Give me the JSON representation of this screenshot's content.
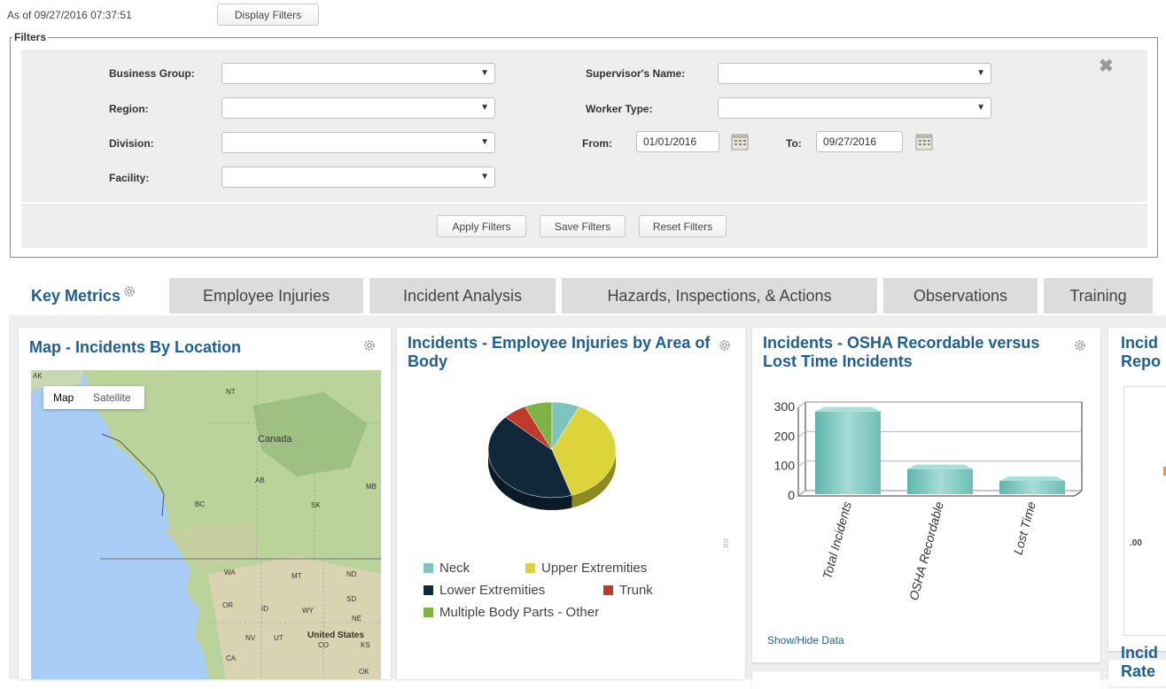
{
  "header": {
    "as_of": "As of 09/27/2016 07:37:51",
    "display_filters": "Display Filters"
  },
  "filters": {
    "legend": "Filters",
    "business_group_label": "Business Group:",
    "region_label": "Region:",
    "division_label": "Division:",
    "facility_label": "Facility:",
    "supervisor_label": "Supervisor's Name:",
    "worker_type_label": "Worker Type:",
    "from_label": "From:",
    "from_value": "01/01/2016",
    "to_label": "To:",
    "to_value": "09/27/2016",
    "apply": "Apply Filters",
    "save": "Save Filters",
    "reset": "Reset Filters",
    "close_icon": "close-icon"
  },
  "tabs": [
    "Key Metrics",
    "Employee Injuries",
    "Incident Analysis",
    "Hazards, Inspections, & Actions",
    "Observations",
    "Training"
  ],
  "map_card": {
    "title": "Map - Incidents By Location",
    "map_btn": "Map",
    "satellite_btn": "Satellite",
    "labels": {
      "ak": "AK",
      "nt": "NT",
      "canada": "Canada",
      "ab": "AB",
      "mb": "MB",
      "bc": "BC",
      "sk": "SK",
      "wa": "WA",
      "mt": "MT",
      "nd": "ND",
      "sd": "SD",
      "or": "OR",
      "id": "ID",
      "wy": "WY",
      "ne": "NE",
      "nv": "NV",
      "ut": "UT",
      "us": "United States",
      "co": "CO",
      "ks": "KS",
      "ca": "CA",
      "ok": "OK"
    }
  },
  "pie_card": {
    "title": "Incidents - Employee Injuries by Area of Body",
    "legend": [
      "Neck",
      "Upper Extremities",
      "Lower Extremities",
      "Trunk",
      "Multiple Body Parts - Other"
    ],
    "colors": [
      "#7ec4be",
      "#dcd43a",
      "#10283a",
      "#c0392b",
      "#7cb342"
    ]
  },
  "bar_card": {
    "title": "Incidents - OSHA Recordable versus Lost Time Incidents",
    "show_hide": "Show/Hide Data"
  },
  "partial_cards": {
    "top_title": "Incid Repo",
    "top_title_l1": "Incid",
    "top_title_l2": "Repo",
    "value_label": ".00",
    "bottom_title_l1": "Incid",
    "bottom_title_l2": "Rate"
  },
  "chart_data": [
    {
      "type": "pie",
      "title": "Incidents - Employee Injuries by Area of Body",
      "categories": [
        "Neck",
        "Upper Extremities",
        "Lower Extremities",
        "Trunk",
        "Multiple Body Parts - Other"
      ],
      "values": [
        7,
        38,
        42,
        6,
        7
      ]
    },
    {
      "type": "bar",
      "title": "Incidents - OSHA Recordable versus Lost Time Incidents",
      "categories": [
        "Total Incidents",
        "OSHA Recordable",
        "Lost Time"
      ],
      "values": [
        280,
        85,
        45
      ],
      "ylim": [
        0,
        300
      ],
      "yticks": [
        "0",
        "100",
        "200",
        "300"
      ],
      "grid": true
    }
  ]
}
